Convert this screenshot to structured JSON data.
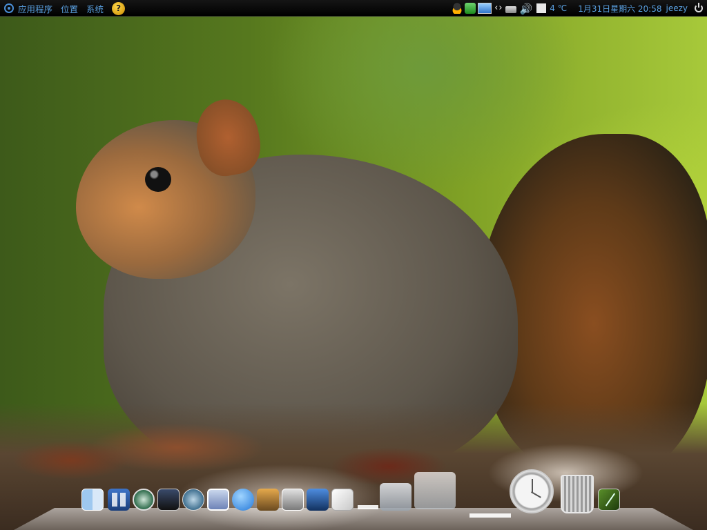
{
  "panel": {
    "menus": [
      "应用程序",
      "位置",
      "系统"
    ],
    "help_icon_label": "?",
    "tray": {
      "temperature": "4 ℃",
      "datetime": "1月31日星期六 20:58",
      "username": "jeezy"
    }
  },
  "dock": {
    "items": [
      "finder-icon",
      "dashboard-icon",
      "time-machine-icon",
      "activity-monitor-icon",
      "safari-icon",
      "preview-icon",
      "ichat-icon",
      "iphoto-icon",
      "photo-booth-icon",
      "video-icon",
      "textedit-icon",
      "stack-icon",
      "stack-icon",
      "clock-icon",
      "trash-icon",
      "terminal-icon"
    ]
  },
  "wallpaper": {
    "subject": "squirrel-wallpaper"
  }
}
